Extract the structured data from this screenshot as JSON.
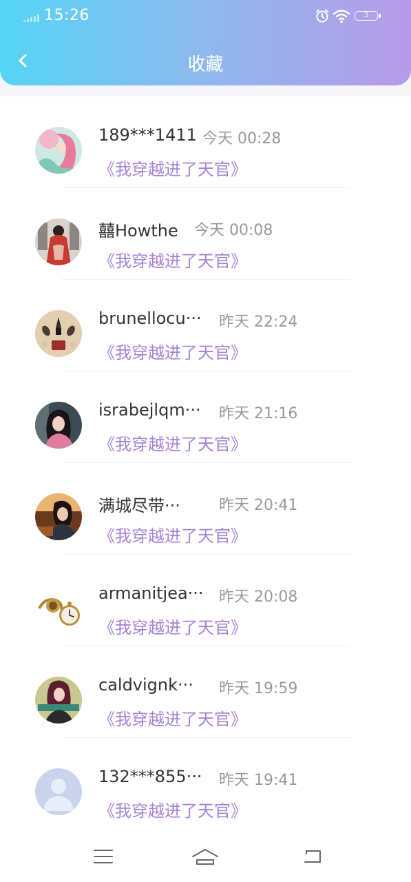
{
  "status_bar": {
    "time": "15:26",
    "battery": "3",
    "icons": [
      "signal-icon",
      "alarm-icon",
      "wifi-icon",
      "battery-icon"
    ]
  },
  "header": {
    "title": "收藏",
    "back_icon": "back-arrow-icon"
  },
  "colors": {
    "header_gradient_start": "#55d4f5",
    "header_gradient_end": "#b79ae9",
    "book_title": "#a583d6",
    "name_text": "#333333",
    "date_text": "#999999"
  },
  "favorites": [
    {
      "name": "189***1411",
      "date": "今天 00:28",
      "book": "《我穿越进了天官》",
      "avatar": "avatar-anime-girl"
    },
    {
      "name": "囍Howthe",
      "date": "今天 00:08",
      "book": "《我穿越进了天官》",
      "avatar": "avatar-red-dress"
    },
    {
      "name": "brunellocu···",
      "date": "昨天 22:24",
      "book": "《我穿越进了天官》",
      "avatar": "avatar-lipsticks"
    },
    {
      "name": "israbejlqm···",
      "date": "昨天 21:16",
      "book": "《我穿越进了天官》",
      "avatar": "avatar-girl-dark"
    },
    {
      "name": "满城尽带···",
      "date": "昨天 20:41",
      "book": "《我穿越进了天官》",
      "avatar": "avatar-girl-warm"
    },
    {
      "name": "armanitjea···",
      "date": "昨天 20:08",
      "book": "《我穿越进了天官》",
      "avatar": "avatar-pocket-watch"
    },
    {
      "name": "caldvignk···",
      "date": "昨天 19:59",
      "book": "《我穿越进了天官》",
      "avatar": "avatar-girl-banner"
    },
    {
      "name": "132***855···",
      "date": "昨天 19:41",
      "book": "《我穿越进了天官》",
      "avatar": "avatar-default"
    }
  ],
  "nav_bar": {
    "icons": [
      "menu-icon",
      "home-icon",
      "back-icon"
    ]
  }
}
